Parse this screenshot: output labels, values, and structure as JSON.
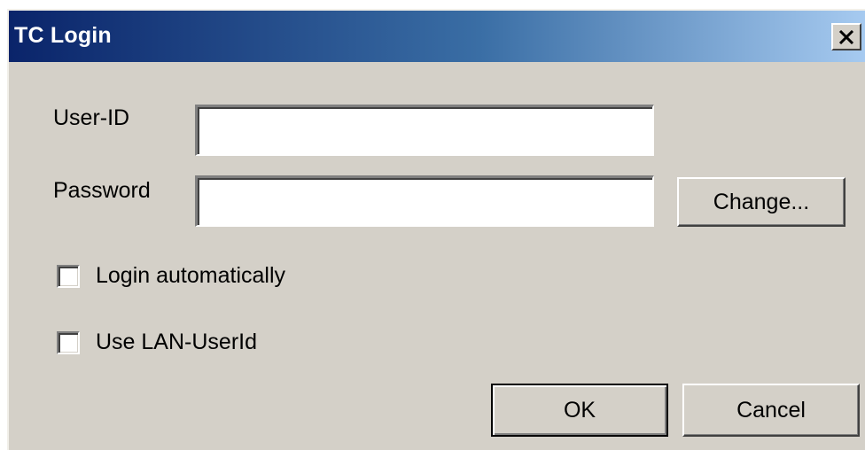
{
  "window": {
    "title": "TC Login",
    "close_label": "×"
  },
  "form": {
    "userid_label": "User-ID",
    "userid_value": "",
    "password_label": "Password",
    "password_value": ""
  },
  "buttons": {
    "change_label": "Change...",
    "ok_label": "OK",
    "cancel_label": "Cancel"
  },
  "options": {
    "login_automatically_label": "Login automatically",
    "login_automatically_checked": false,
    "use_lan_userid_label": "Use LAN-UserId",
    "use_lan_userid_checked": false
  },
  "icons": {
    "close": "close-icon"
  }
}
